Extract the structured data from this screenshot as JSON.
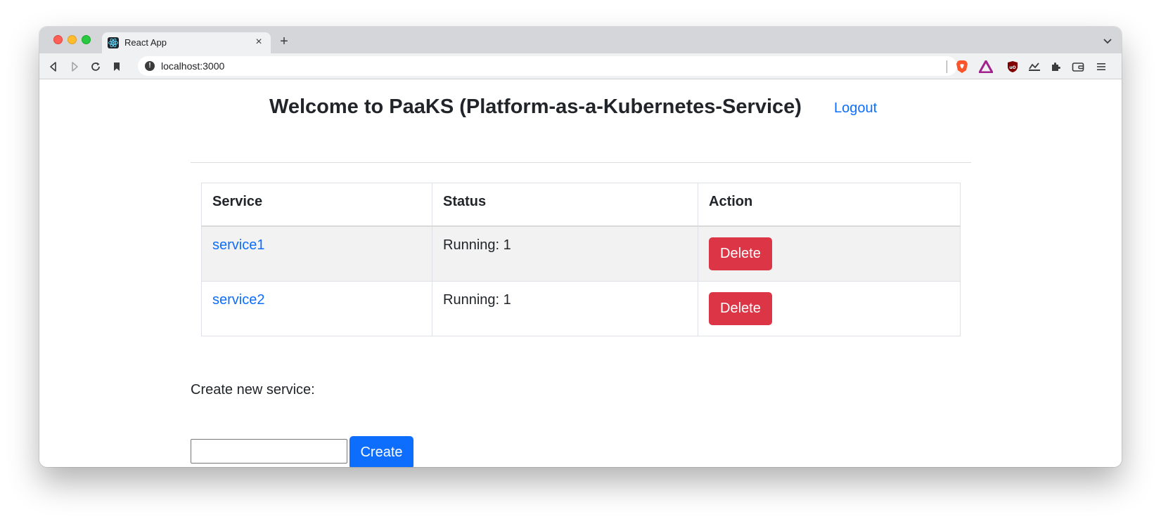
{
  "browser": {
    "tab_title": "React App",
    "tab_close": "×",
    "new_tab": "+",
    "url": "localhost:3000",
    "url_info": "!"
  },
  "page": {
    "title": "Welcome to PaaKS (Platform-as-a-Kubernetes-Service)",
    "logout_label": "Logout"
  },
  "table": {
    "headers": [
      "Service",
      "Status",
      "Action"
    ],
    "rows": [
      {
        "service": "service1",
        "status": "Running: 1",
        "action": "Delete"
      },
      {
        "service": "service2",
        "status": "Running: 1",
        "action": "Delete"
      }
    ]
  },
  "create": {
    "label": "Create new service:",
    "input_value": "",
    "button_label": "Create"
  },
  "colors": {
    "primary": "#0d6efd",
    "danger": "#dc3545",
    "text": "#212529"
  }
}
